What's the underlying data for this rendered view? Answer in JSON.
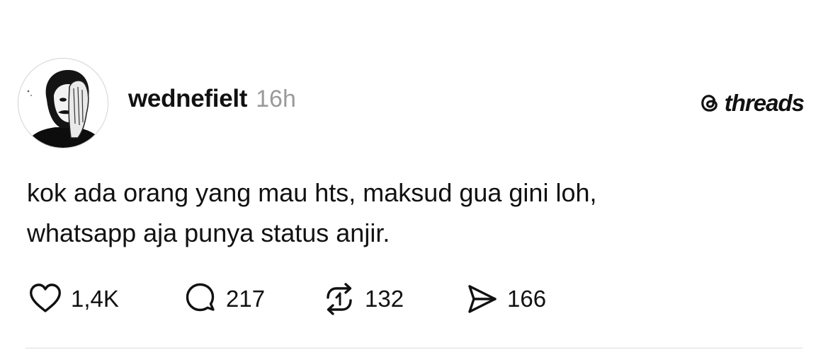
{
  "post": {
    "username": "wednefielt",
    "time": "16h",
    "brand": "threads",
    "content": {
      "lines": [
        "kok ada orang yang mau hts, maksud gua gini loh,",
        "whatsapp aja punya status anjir."
      ]
    },
    "actions": {
      "likes": "1,4K",
      "replies": "217",
      "reposts": "132",
      "shares": "166"
    }
  },
  "icons": {
    "brand": "threads-logo-icon",
    "like": "heart-icon",
    "reply": "speech-bubble-icon",
    "repost": "repost-arrows-icon",
    "share": "send-icon"
  },
  "colors": {
    "text": "#111111",
    "muted": "#9a9a9a",
    "divider": "#dcdcdc",
    "background": "#ffffff"
  }
}
